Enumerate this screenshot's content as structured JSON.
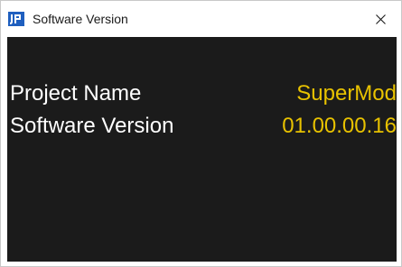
{
  "window": {
    "title": "Software Version",
    "icon": "app-logo-icon",
    "close_icon": "close-icon"
  },
  "info": {
    "project_name_label": "Project Name",
    "project_name_value": "SuperMod",
    "software_version_label": "Software Version",
    "software_version_value": "01.00.00.16"
  },
  "colors": {
    "content_background": "#1b1b1b",
    "label_text": "#ffffff",
    "value_text": "#e8c200",
    "icon_blue": "#1f5fbf"
  }
}
